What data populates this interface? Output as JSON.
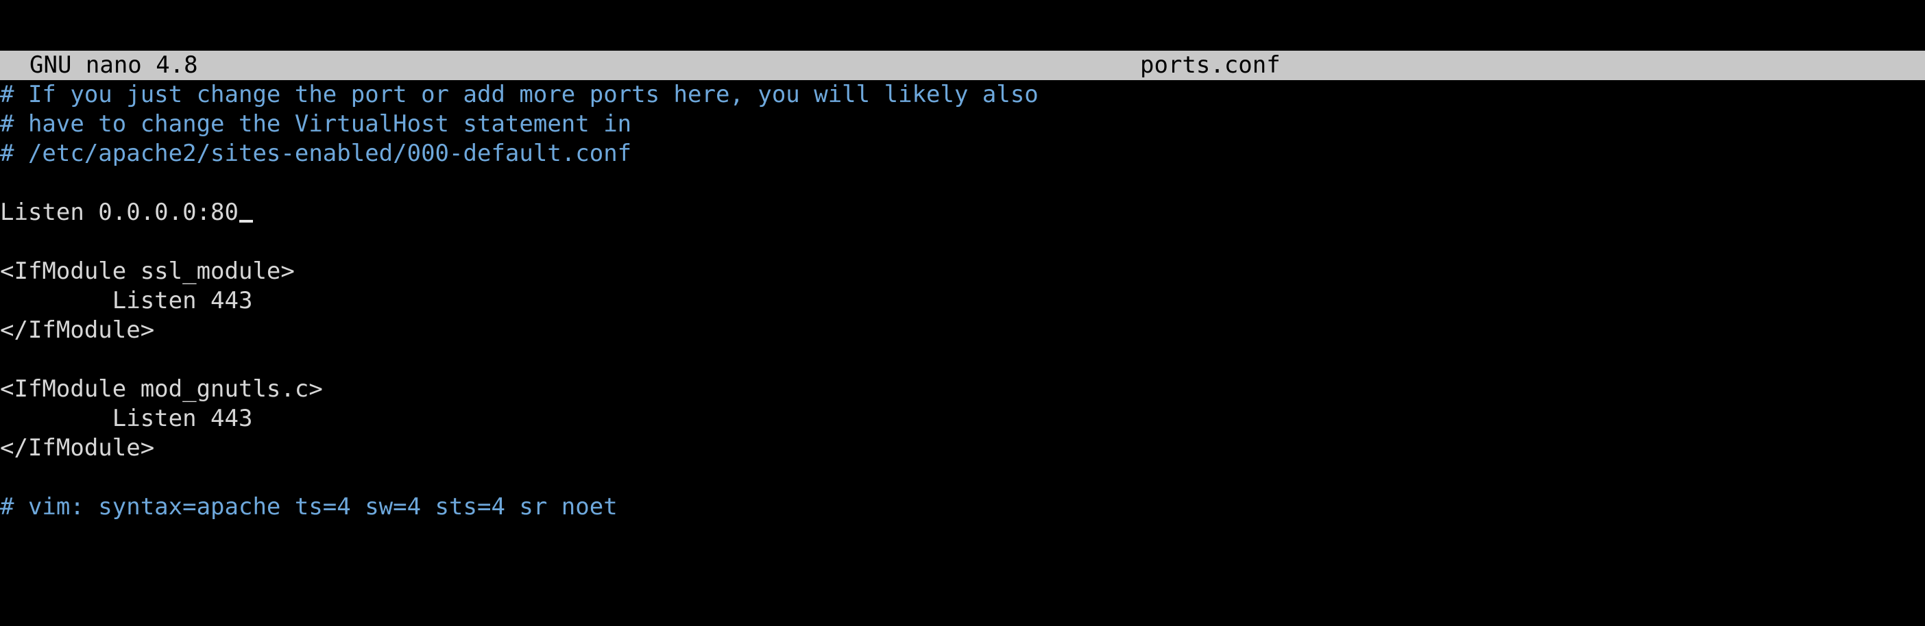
{
  "titlebar": {
    "app_name": "GNU nano 4.8",
    "file_name": "ports.conf"
  },
  "editor": {
    "lines": [
      "# If you just change the port or add more ports here, you will likely also",
      "# have to change the VirtualHost statement in",
      "# /etc/apache2/sites-enabled/000-default.conf",
      "",
      "Listen 0.0.0.0:80",
      "",
      "<IfModule ssl_module>",
      "        Listen 443",
      "</IfModule>",
      "",
      "<IfModule mod_gnutls.c>",
      "        Listen 443",
      "</IfModule>",
      "",
      "# vim: syntax=apache ts=4 sw=4 sts=4 sr noet"
    ]
  },
  "colors": {
    "background": "#000000",
    "titlebar_bg": "#c8c8c8",
    "comment": "#6ea8dc",
    "text": "#d7d7d7"
  }
}
